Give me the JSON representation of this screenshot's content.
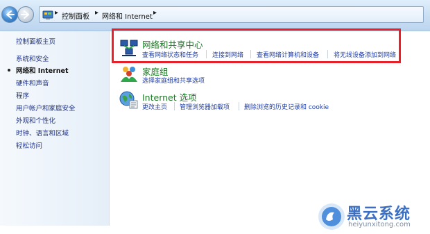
{
  "address_bar": {
    "crumbs": [
      "控制面板",
      "网络和 Internet"
    ]
  },
  "sidebar": {
    "home": "控制面板主页",
    "items": [
      "系统和安全",
      "网络和 Internet",
      "硬件和声音",
      "程序",
      "用户帐户和家庭安全",
      "外观和个性化",
      "时钟、语言和区域",
      "轻松访问"
    ],
    "active_index": 1
  },
  "categories": [
    {
      "title": "网络和共享中心",
      "icon": "network-sharing-icon",
      "links": [
        "查看网络状态和任务",
        "连接到网络",
        "查看网络计算机和设备",
        "将无线设备添加到网络"
      ]
    },
    {
      "title": "家庭组",
      "icon": "homegroup-icon",
      "links": [
        "选择家庭组和共享选项"
      ]
    },
    {
      "title": "Internet 选项",
      "icon": "internet-options-icon",
      "links": [
        "更改主页",
        "管理浏览器加载项",
        "删除浏览的历史记录和 cookie"
      ]
    }
  ],
  "highlight_color": "#e8202a",
  "watermark": {
    "title": "黑云系统",
    "url": "heiyunxitong.com"
  }
}
